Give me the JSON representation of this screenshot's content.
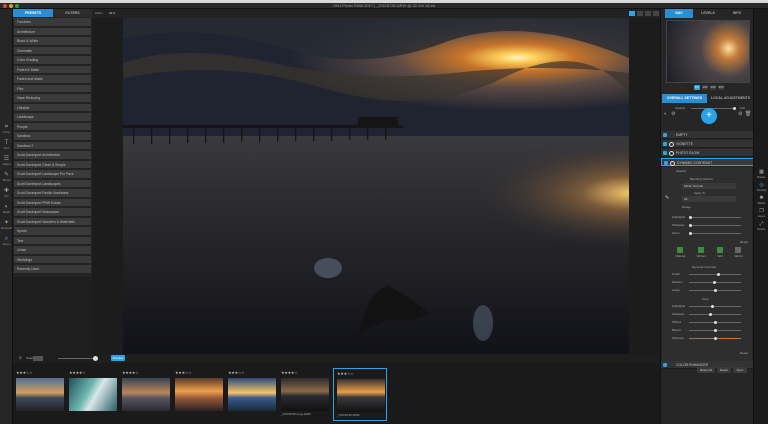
{
  "window_title": "ON1 Photo RAW 2017 | _DSC8730.ARW @ 32.3% 16-bit",
  "left_tabs": [
    "PRESETS",
    "FILTERS"
  ],
  "presets": [
    "Favorites",
    "Architecture",
    "Black & White",
    "Cinematic",
    "Color Grading",
    "Faded & Matte",
    "Faded and Matte",
    "Film",
    "Haze Reducing",
    "Lifestyle",
    "Landscape",
    "People",
    "Sandbox",
    "Sandbox 2",
    "Scott Davenport Architecture",
    "Scott Davenport Clean & Simple",
    "Scott Davenport Landscape Pro Pack",
    "Scott Davenport Landscapes",
    "Scott Davenport Pacific Northwest",
    "Scott Davenport PRW Extras",
    "Scott Davenport Seascapes",
    "Scott Davenport Wonders & Waterfalls",
    "Sports",
    "Text",
    "Urban",
    "Weddings",
    "Recently Used"
  ],
  "tools": [
    {
      "icon": "crop-icon",
      "label": "Crop"
    },
    {
      "icon": "text-icon",
      "label": "Text"
    },
    {
      "icon": "adjust-icon",
      "label": "Adjust"
    },
    {
      "icon": "brush-icon",
      "label": "Brush"
    },
    {
      "icon": "fix-icon",
      "label": "Fix"
    },
    {
      "icon": "mask-icon",
      "label": "Mask"
    },
    {
      "icon": "retouch-icon",
      "label": "Retouch"
    },
    {
      "icon": "zoom-icon",
      "label": "Zoom"
    }
  ],
  "view_toolbar": {
    "zoom_label": "Zoom",
    "zoom_value": "32.3"
  },
  "filmstrip": {
    "search_placeholder": "Search",
    "badge": "Preview",
    "thumbs": [
      {
        "stars": "★★★☆☆",
        "name": ""
      },
      {
        "stars": "★★★★☆",
        "name": ""
      },
      {
        "stars": "★★★★☆",
        "name": ""
      },
      {
        "stars": "★★★☆☆",
        "name": ""
      },
      {
        "stars": "★★★☆☆",
        "name": ""
      },
      {
        "stars": "★★★★☆",
        "name": "_DSC8730-copy.ARW"
      },
      {
        "stars": "★★★☆☆",
        "name": "_DSC8730.ARW"
      }
    ]
  },
  "right_tabs": [
    "NAV",
    "LEVELS",
    "INFO"
  ],
  "zoom_buttons": [
    "Fit",
    "100",
    "200",
    "300"
  ],
  "settings_tabs": [
    "OVERALL SETTINGS",
    "LOCAL ADJUSTMENTS"
  ],
  "opacity_label": "Opacity",
  "opacity_value": "100",
  "filters": [
    "EMPTY",
    "VIGNETTE",
    "PHOTO GLOW",
    "DYNAMIC CONTRAST"
  ],
  "dc": {
    "opacity": "Opacity",
    "blending": "Blending Options",
    "mode": "Mode: Normal",
    "apply_to": "Apply To",
    "all": "All",
    "range": "Range",
    "highlights": "Highlights",
    "shadows": "Shadows",
    "zoom": "Zoom",
    "reset": "Reset",
    "presets": [
      "Natural",
      "Vibrant",
      "Soft",
      "Warm"
    ],
    "dynamic_contrast": "Dynamic Contrast",
    "small": "Small",
    "medium": "Medium",
    "large": "Large",
    "tone": "Tone",
    "tone_highlights": "Highlights",
    "tone_shadows": "Shadows",
    "whites": "Whites",
    "blacks": "Blacks",
    "vibrance": "Vibrance"
  },
  "color_enhancer": "COLOR ENHANCER",
  "bottom_buttons": [
    "Reset All",
    "Reset",
    "Sync"
  ],
  "modules": [
    "Browse",
    "Develop",
    "Effects",
    "Layers",
    "Resize"
  ],
  "colors": {
    "accent": "#2aa3e8",
    "panel": "#262626",
    "preset_bg": "#3a3a3a"
  }
}
